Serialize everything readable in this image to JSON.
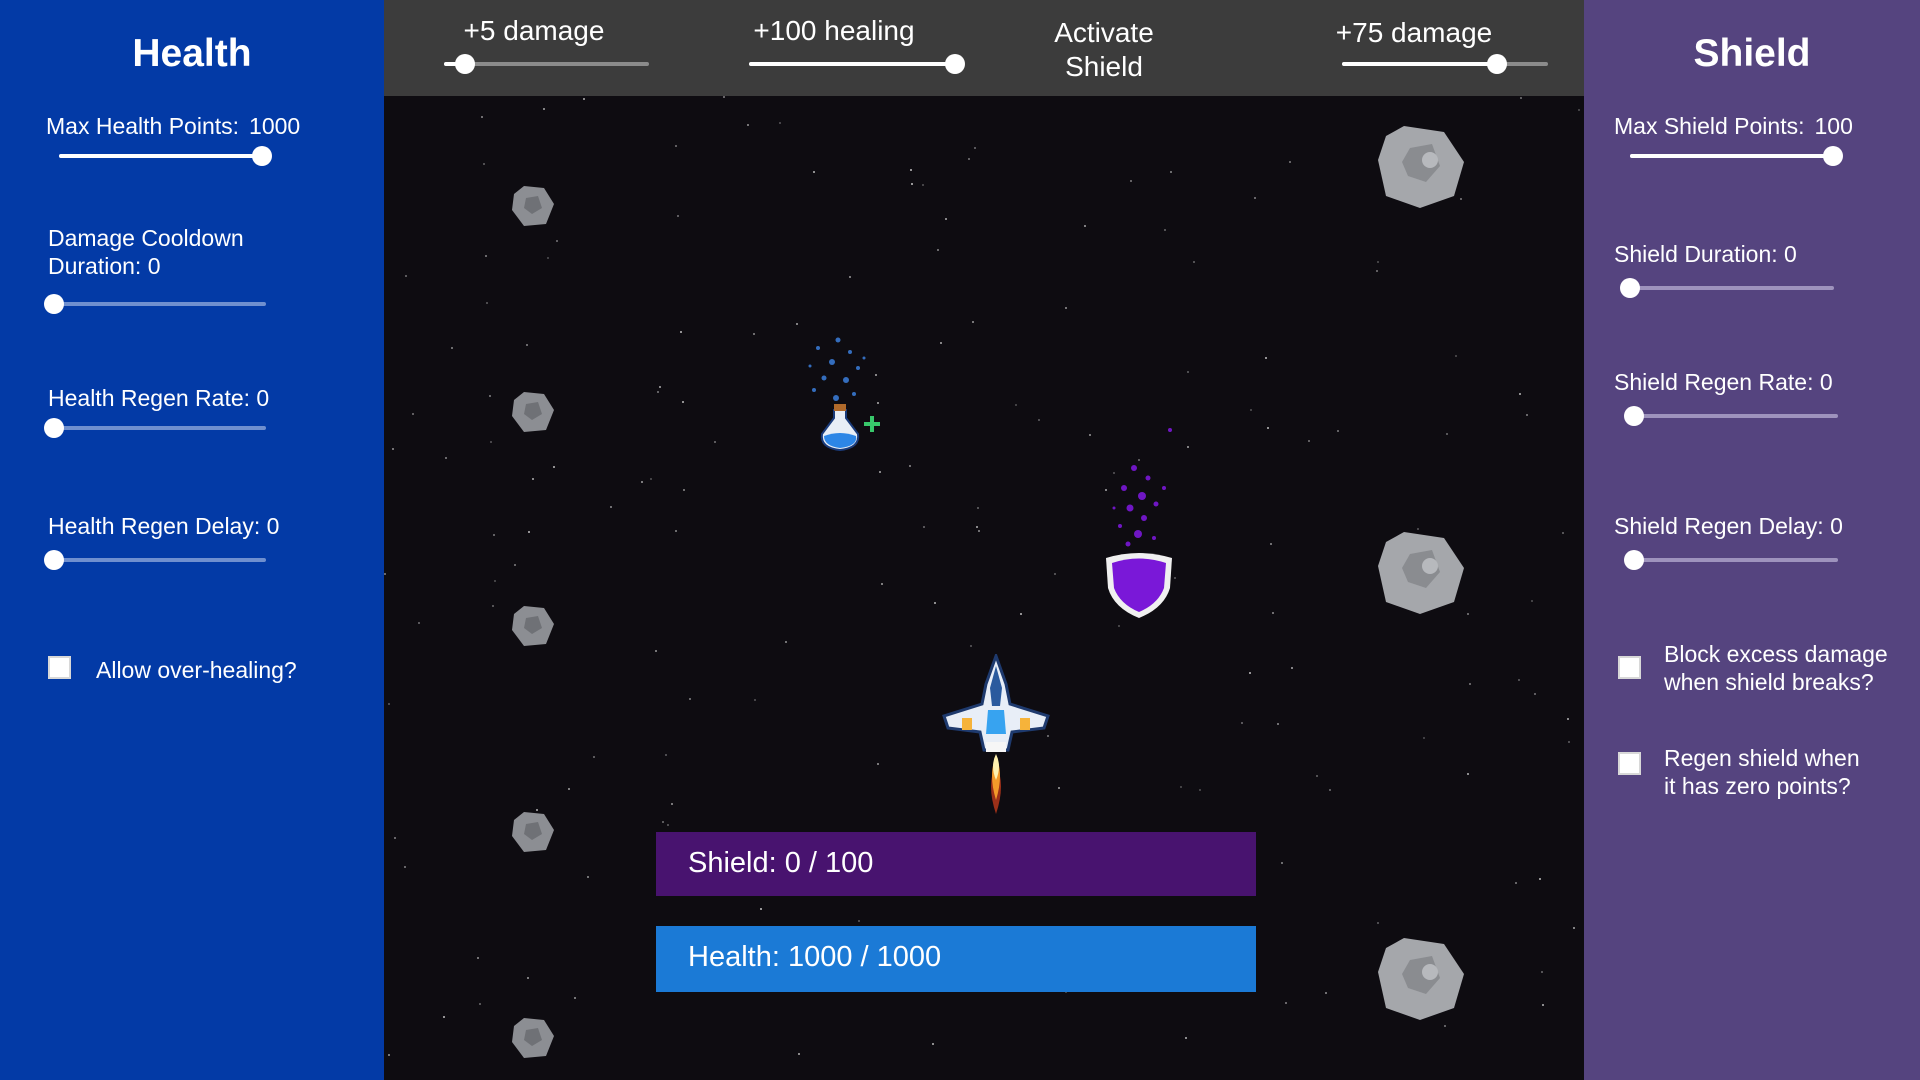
{
  "health_panel": {
    "title": "Health",
    "max_health_label": "Max Health Points:",
    "max_health_value": "1000",
    "max_health_level": 1.0,
    "damage_cooldown_label": "Damage Cooldown\nDuration: 0",
    "damage_cooldown_line1": "Damage Cooldown",
    "damage_cooldown_line2": "Duration: 0",
    "damage_cooldown_level": 0,
    "regen_rate_label": "Health Regen Rate: 0",
    "regen_rate_level": 0,
    "regen_delay_label": "Health Regen Delay: 0",
    "regen_delay_level": 0,
    "overheal_label": "Allow over-healing?",
    "overheal_checked": false
  },
  "shield_panel": {
    "title": "Shield",
    "max_shield_label": "Max Shield Points:",
    "max_shield_value": "100",
    "max_shield_level": 1.0,
    "duration_label": "Shield Duration: 0",
    "duration_level": 0,
    "regen_rate_label": "Shield Regen Rate: 0",
    "regen_rate_level": 0,
    "regen_delay_label": "Shield Regen Delay: 0",
    "regen_delay_level": 0,
    "block_excess_line1": "Block excess damage",
    "block_excess_line2": "when shield breaks?",
    "block_excess_checked": false,
    "regen_zero_line1": "Regen shield when",
    "regen_zero_line2": "it has zero points?",
    "regen_zero_checked": false
  },
  "topbar": {
    "damage_small_label": "+5 damage",
    "damage_small_level": 0.1,
    "healing_label": "+100 healing",
    "healing_level": 1.0,
    "activate_line1": "Activate",
    "activate_line2": "Shield",
    "damage_large_label": "+75 damage",
    "damage_large_level": 0.75
  },
  "status": {
    "shield_text": "Shield: 0 / 100",
    "health_text": "Health: 1000 / 1000"
  },
  "colors": {
    "health_panel": "#033aa6",
    "shield_panel": "#55447f",
    "shield_bar": "#48136f",
    "health_bar": "#1b7ad6",
    "shield_pickup": "#7a18d8"
  },
  "icons": {
    "ship": "spaceship-icon",
    "shield_pickup": "shield-icon",
    "potion": "health-potion-icon",
    "asteroid": "asteroid-icon"
  }
}
